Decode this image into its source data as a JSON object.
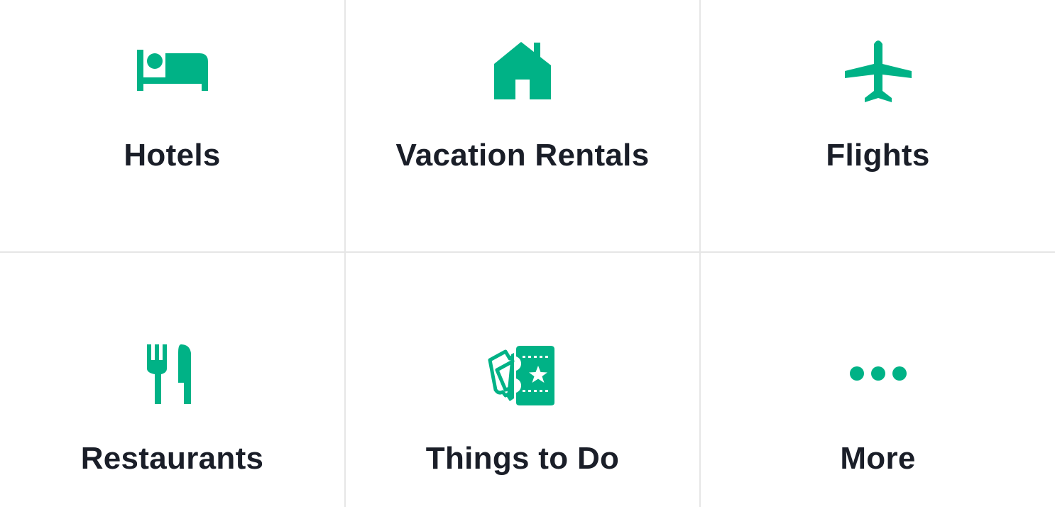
{
  "theme": {
    "accent": "#00b286",
    "text": "#1a1e28",
    "divider": "#e6e6e6",
    "background": "#ffffff"
  },
  "categories": [
    {
      "label": "Hotels",
      "icon": "bed-icon"
    },
    {
      "label": "Vacation Rentals",
      "icon": "house-icon"
    },
    {
      "label": "Flights",
      "icon": "airplane-icon"
    },
    {
      "label": "Restaurants",
      "icon": "fork-knife-icon"
    },
    {
      "label": "Things to Do",
      "icon": "ticket-icon"
    },
    {
      "label": "More",
      "icon": "more-dots-icon"
    }
  ]
}
